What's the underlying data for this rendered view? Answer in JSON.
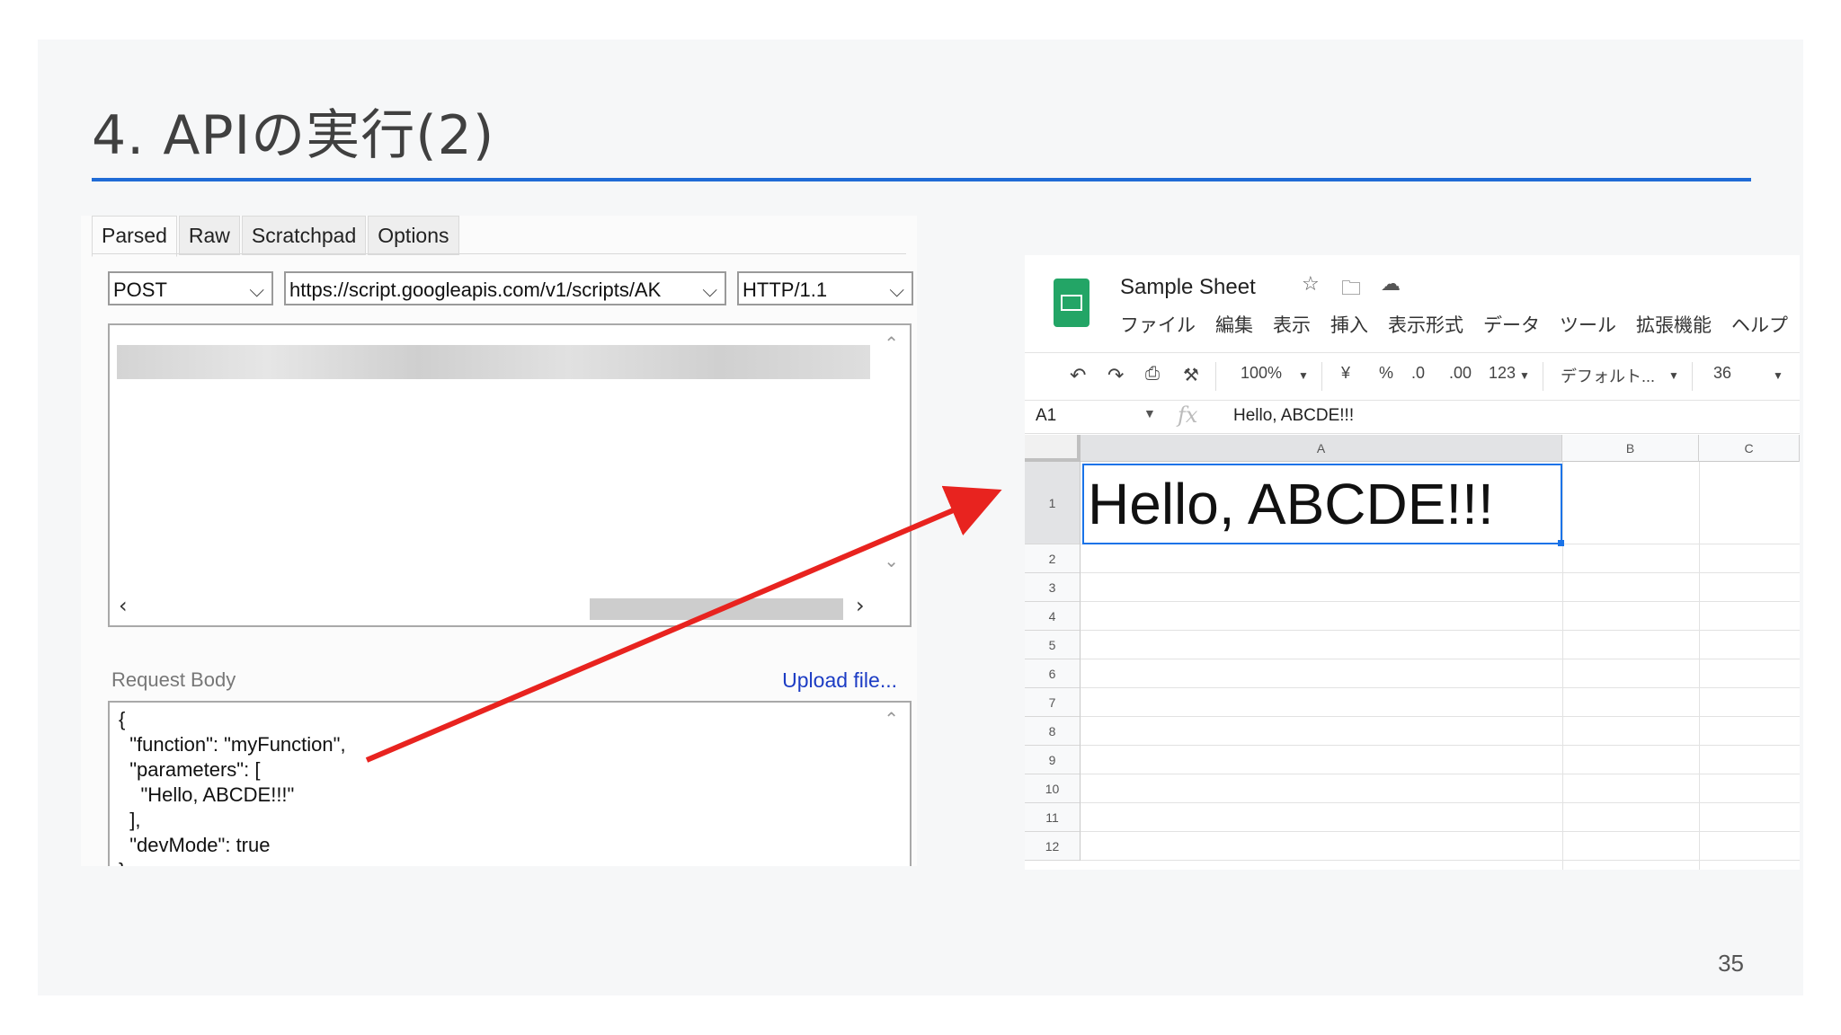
{
  "slide": {
    "title": "4. APIの実行(2)",
    "page_number": "35",
    "accent_color": "#1f6bd6"
  },
  "request_tool": {
    "tabs": [
      "Parsed",
      "Raw",
      "Scratchpad",
      "Options"
    ],
    "active_tab": "Parsed",
    "method": "POST",
    "url": "https://script.googleapis.com/v1/scripts/AK",
    "protocol": "HTTP/1.1",
    "request_body_label": "Request Body",
    "upload_label": "Upload file...",
    "body_lines": [
      "{",
      "  \"function\": \"myFunction\",",
      "  \"parameters\": [",
      "    \"Hello, ABCDE!!!\"",
      "  ],",
      "  \"devMode\": true",
      "}"
    ]
  },
  "sheets": {
    "doc_title": "Sample Sheet",
    "title_icons": [
      "star-icon",
      "move-to-folder-icon",
      "cloud-status-icon"
    ],
    "menu": [
      "ファイル",
      "編集",
      "表示",
      "挿入",
      "表示形式",
      "データ",
      "ツール",
      "拡張機能",
      "ヘルプ"
    ],
    "toolbar": {
      "zoom": "100%",
      "currency": "¥",
      "percent": "%",
      "decrease_decimal": ".0",
      "increase_decimal": ".00",
      "number_format": "123",
      "font": "デフォルト...",
      "font_size": "36"
    },
    "name_box": "A1",
    "formula_value": "Hello, ABCDE!!!",
    "columns": [
      "A",
      "B",
      "C"
    ],
    "rows": [
      "1",
      "2",
      "3",
      "4",
      "5",
      "6",
      "7",
      "8",
      "9",
      "10",
      "11",
      "12"
    ],
    "a1_value": "Hello, ABCDE!!!"
  },
  "annotation": {
    "arrow_color": "#e8231f"
  }
}
